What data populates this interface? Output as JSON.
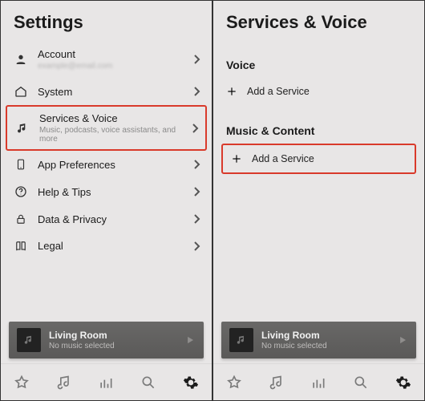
{
  "left": {
    "title": "Settings",
    "items": {
      "account": {
        "label": "Account",
        "sub": "example@email.com"
      },
      "system": {
        "label": "System"
      },
      "services": {
        "label": "Services & Voice",
        "sub": "Music, podcasts, voice assistants, and more"
      },
      "app": {
        "label": "App Preferences"
      },
      "help": {
        "label": "Help & Tips"
      },
      "data": {
        "label": "Data & Privacy"
      },
      "legal": {
        "label": "Legal"
      }
    }
  },
  "right": {
    "title": "Services & Voice",
    "voice_header": "Voice",
    "voice_add": "Add a Service",
    "music_header": "Music & Content",
    "music_add": "Add a Service"
  },
  "player": {
    "room": "Living Room",
    "status": "No music selected"
  }
}
